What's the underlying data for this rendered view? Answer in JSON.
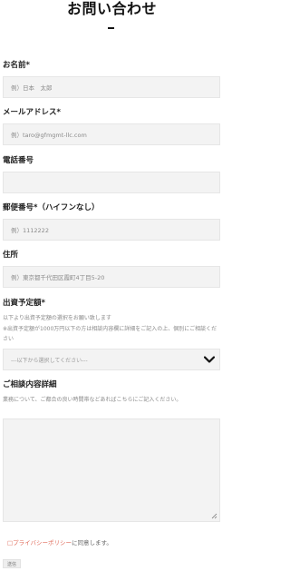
{
  "page": {
    "title": "お問い合わせ"
  },
  "form": {
    "name": {
      "label": "お名前*",
      "placeholder": "例）日本　太郎"
    },
    "email": {
      "label": "メールアドレス*",
      "placeholder": "例）taro@gfmgmt-llc.com"
    },
    "phone": {
      "label": "電話番号",
      "placeholder": ""
    },
    "postal": {
      "label": "郵便番号*（ハイフンなし）",
      "placeholder": "例）1112222"
    },
    "address": {
      "label": "住所",
      "placeholder": "例）東京都千代田区霞町4丁目5-20"
    },
    "capital": {
      "label": "出資予定額*",
      "help_line1": "以下より出資予定額の選択をお願い致します",
      "help_line2": "※出資予定額が1000万円以下の方は相談内容欄に詳細をご記入の上、個別にご相談ください",
      "selected": "---以下から選択してください---"
    },
    "details": {
      "label": "ご相談内容詳細",
      "help": "業務について、ご都合の良い時間帯などあればこちらにご記入ください。"
    },
    "privacy": {
      "link_text": "□プライバシーポリシー",
      "suffix": "に同意します。"
    },
    "submit_label": "送信"
  }
}
